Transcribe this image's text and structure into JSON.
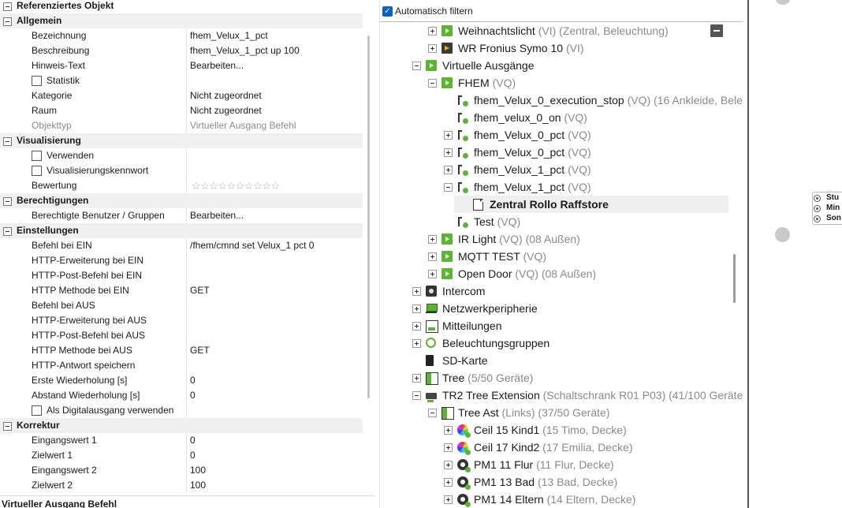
{
  "property_grid": {
    "root_title": "Referenziertes Objekt",
    "bottom_label": "Virtueller Ausgang Befehl",
    "categories": [
      {
        "title": "Allgemein",
        "rows": [
          {
            "label": "Bezeichnung",
            "value": "fhem_Velux_1_pct"
          },
          {
            "label": "Beschreibung",
            "value": "fhem_Velux_1_pct up 100"
          },
          {
            "label": "Hinweis-Text",
            "value": "Bearbeiten..."
          },
          {
            "label": "Statistik",
            "value": ""
          },
          {
            "label": "Kategorie",
            "value": "Nicht zugeordnet"
          },
          {
            "label": "Raum",
            "value": "Nicht zugeordnet"
          },
          {
            "label": "Objekttyp",
            "value": "Virtueller Ausgang Befehl"
          }
        ]
      },
      {
        "title": "Visualisierung",
        "rows": [
          {
            "label": "Verwenden",
            "value": ""
          },
          {
            "label": "Visualisierungskennwort",
            "value": ""
          },
          {
            "label": "Bewertung",
            "value": "☆☆☆☆☆☆☆☆☆☆",
            "rating": 0
          }
        ]
      },
      {
        "title": "Berechtigungen",
        "rows": [
          {
            "label": "Berechtigte Benutzer / Gruppen",
            "value": "Bearbeiten..."
          }
        ]
      },
      {
        "title": "Einstellungen",
        "rows": [
          {
            "label": "Befehl bei EIN",
            "value": "/fhem/cmnd set Velux_1 pct 0"
          },
          {
            "label": "HTTP-Erweiterung bei EIN",
            "value": ""
          },
          {
            "label": "HTTP-Post-Befehl bei EIN",
            "value": ""
          },
          {
            "label": "HTTP Methode bei EIN",
            "value": "GET"
          },
          {
            "label": "Befehl bei AUS",
            "value": ""
          },
          {
            "label": "HTTP-Erweiterung bei AUS",
            "value": ""
          },
          {
            "label": "HTTP-Post-Befehl bei AUS",
            "value": ""
          },
          {
            "label": "HTTP Methode bei AUS",
            "value": "GET"
          },
          {
            "label": "HTTP-Antwort speichern",
            "value": ""
          },
          {
            "label": "Erste Wiederholung [s]",
            "value": "0"
          },
          {
            "label": "Abstand Wiederholung [s]",
            "value": "0"
          },
          {
            "label": "Als Digitalausgang verwenden",
            "value": ""
          }
        ]
      },
      {
        "title": "Korrektur",
        "rows": [
          {
            "label": "Eingangswert 1",
            "value": "0"
          },
          {
            "label": "Zielwert 1",
            "value": "0"
          },
          {
            "label": "Eingangswert 2",
            "value": "100"
          },
          {
            "label": "Zielwert 2",
            "value": "100"
          }
        ]
      }
    ]
  },
  "tree": {
    "filter_label": "Automatisch filtern",
    "filter_checked": true,
    "nodes": [
      {
        "name": "Weihnachtslicht",
        "desc": "(VI) (Zentral, Beleuchtung)",
        "icon": "green-input-icon"
      },
      {
        "name": "WR Fronius Symo 10",
        "desc": "(VI)",
        "icon": "inverter-icon"
      },
      {
        "name": "Virtuelle Ausgänge",
        "desc": "",
        "icon": "green-input-icon"
      },
      {
        "name": "FHEM",
        "desc": "(VQ)",
        "icon": "green-input-icon"
      },
      {
        "name": "fhem_Velux_0_execution_stop",
        "desc": "(VQ) (16 Ankleide, Bele",
        "icon": "virtual-output-icon"
      },
      {
        "name": "fhem_velux_0_on",
        "desc": "(VQ)",
        "icon": "virtual-output-icon"
      },
      {
        "name": "fhem_Velux_0_pct",
        "desc": "(VQ)",
        "icon": "virtual-output-icon"
      },
      {
        "name": "fhem_Velux_0_pct",
        "desc": "(VQ)",
        "icon": "virtual-output-icon"
      },
      {
        "name": "fhem_Velux_1_pct",
        "desc": "(VQ)",
        "icon": "virtual-output-icon"
      },
      {
        "name": "fhem_Velux_1_pct",
        "desc": "(VQ)",
        "icon": "virtual-output-icon"
      },
      {
        "name": "Zentral Rollo Raffstore",
        "desc": "",
        "icon": "document-icon"
      },
      {
        "name": "Test",
        "desc": "(VQ)",
        "icon": "virtual-output-icon"
      },
      {
        "name": "IR Light",
        "desc": "(VQ) (08 Außen)",
        "icon": "green-input-icon"
      },
      {
        "name": "MQTT TEST",
        "desc": "(VQ)",
        "icon": "green-input-icon"
      },
      {
        "name": "Open Door",
        "desc": "(VQ) (08 Außen)",
        "icon": "green-input-icon"
      },
      {
        "name": "Intercom",
        "desc": "",
        "icon": "intercom-icon"
      },
      {
        "name": "Netzwerkperipherie",
        "desc": "",
        "icon": "network-icon"
      },
      {
        "name": "Mitteilungen",
        "desc": "",
        "icon": "messages-icon"
      },
      {
        "name": "Beleuchtungsgruppen",
        "desc": "",
        "icon": "lighting-group-icon"
      },
      {
        "name": "SD-Karte",
        "desc": "",
        "icon": "sd-card-icon"
      },
      {
        "name": "Tree",
        "desc": "(5/50 Geräte)",
        "icon": "tree-icon"
      },
      {
        "name": "TR2 Tree Extension",
        "desc": "(Schaltschrank R01 P03) (41/100 Geräte",
        "icon": "tree-extension-icon"
      },
      {
        "name": "Tree Ast",
        "desc": "(Links) (37/50 Geräte)",
        "icon": "tree-icon"
      },
      {
        "name": "Ceil 15 Kind1",
        "desc": "(15 Timo, Decke)",
        "icon": "rgb-light-icon"
      },
      {
        "name": "Ceil 17 Kind2",
        "desc": "(17 Emilia, Decke)",
        "icon": "rgb-light-icon"
      },
      {
        "name": "PM1 11 Flur",
        "desc": "(11 Flur, Decke)",
        "icon": "presence-sensor-icon"
      },
      {
        "name": "PM1 13 Bad",
        "desc": "(13 Bad, Decke)",
        "icon": "presence-sensor-icon"
      },
      {
        "name": "PM1 14 Eltern",
        "desc": "(14 Eltern, Decke)",
        "icon": "presence-sensor-icon"
      }
    ]
  },
  "canvas": {
    "ports": [
      "Stu",
      "Min",
      "Son"
    ]
  }
}
